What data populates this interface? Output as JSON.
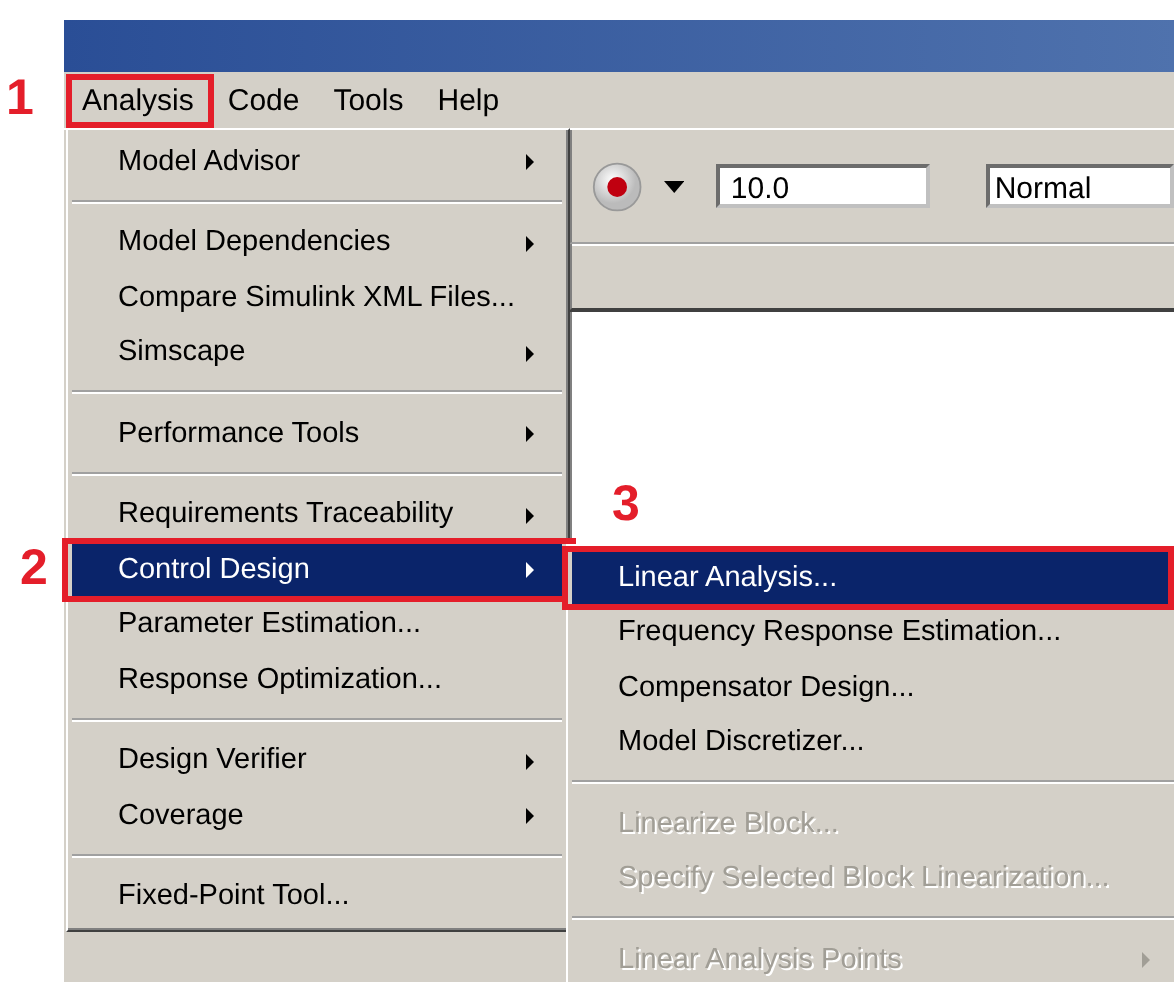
{
  "menubar": [
    {
      "label": "Analysis",
      "callout": "1"
    },
    {
      "label": "Code"
    },
    {
      "label": "Tools"
    },
    {
      "label": "Help"
    }
  ],
  "toolbar": {
    "stop_time": "10.0",
    "mode": "Normal"
  },
  "analysis_menu": {
    "items": [
      {
        "kind": "item",
        "label": "Model Advisor",
        "submenu": true,
        "selected": false
      },
      {
        "kind": "separator"
      },
      {
        "kind": "item",
        "label": "Model Dependencies",
        "submenu": true,
        "selected": false
      },
      {
        "kind": "item",
        "label": "Compare Simulink XML Files...",
        "submenu": false,
        "selected": false
      },
      {
        "kind": "item",
        "label": "Simscape",
        "submenu": true,
        "selected": false
      },
      {
        "kind": "separator"
      },
      {
        "kind": "item",
        "label": "Performance Tools",
        "submenu": true,
        "selected": false
      },
      {
        "kind": "separator"
      },
      {
        "kind": "item",
        "label": "Requirements Traceability",
        "submenu": true,
        "selected": false
      },
      {
        "kind": "item",
        "label": "Control Design",
        "submenu": true,
        "selected": true,
        "callout": "2"
      },
      {
        "kind": "item",
        "label": "Parameter Estimation...",
        "submenu": false,
        "selected": false
      },
      {
        "kind": "item",
        "label": "Response Optimization...",
        "submenu": false,
        "selected": false
      },
      {
        "kind": "separator"
      },
      {
        "kind": "item",
        "label": "Design Verifier",
        "submenu": true,
        "selected": false
      },
      {
        "kind": "item",
        "label": "Coverage",
        "submenu": true,
        "selected": false
      },
      {
        "kind": "separator"
      },
      {
        "kind": "item",
        "label": "Fixed-Point Tool...",
        "submenu": false,
        "selected": false
      }
    ]
  },
  "control_design_menu": {
    "items": [
      {
        "kind": "item",
        "label": "Linear Analysis...",
        "submenu": false,
        "selected": true,
        "disabled": false,
        "callout": "3"
      },
      {
        "kind": "item",
        "label": "Frequency Response Estimation...",
        "submenu": false,
        "selected": false,
        "disabled": false
      },
      {
        "kind": "item",
        "label": "Compensator Design...",
        "submenu": false,
        "selected": false,
        "disabled": false
      },
      {
        "kind": "item",
        "label": "Model Discretizer...",
        "submenu": false,
        "selected": false,
        "disabled": false
      },
      {
        "kind": "separator"
      },
      {
        "kind": "item",
        "label": "Linearize Block...",
        "submenu": false,
        "selected": false,
        "disabled": true
      },
      {
        "kind": "item",
        "label": "Specify Selected Block Linearization...",
        "submenu": false,
        "selected": false,
        "disabled": true
      },
      {
        "kind": "separator"
      },
      {
        "kind": "item",
        "label": "Linear Analysis Points",
        "submenu": true,
        "selected": false,
        "disabled": true
      }
    ]
  }
}
